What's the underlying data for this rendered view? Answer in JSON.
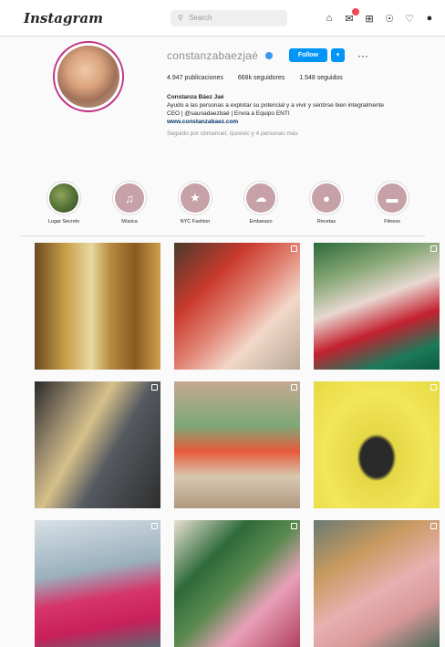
{
  "app": {
    "logo": "Instagram",
    "search_placeholder": "Search",
    "nav_icons": [
      "home-icon",
      "direct-icon",
      "new-post-icon",
      "explore-icon",
      "activity-icon",
      "profile-icon"
    ]
  },
  "profile": {
    "username": "constanzabaezjaé",
    "verified": true,
    "follow_label": "Follow",
    "more_label": "···",
    "stats": {
      "posts": "4.947 publicaciones",
      "followers": "668k seguidores",
      "following": "1.548 seguidos"
    },
    "bio": {
      "name": "Constanza Báez Jaé",
      "line1": "Ayudo a las personas a explotar su potencial y a vivir y sentirse bien integralmente",
      "line2": "CEO | @saunadaezbaé | Envía a Equipo ENTI",
      "link": "www.constanzabaez.com",
      "followed_by": "Seguido por cbmanuel, rjucevic y 4 personas más"
    }
  },
  "highlights": [
    {
      "label": "Lugar Secreto",
      "icon": "photo"
    },
    {
      "label": "Música",
      "icon": "music-icon"
    },
    {
      "label": "NYC Fashion",
      "icon": "fashion-icon"
    },
    {
      "label": "Embarazo",
      "icon": "baby-icon"
    },
    {
      "label": "Recetas",
      "icon": "apple-icon"
    },
    {
      "label": "Fitness",
      "icon": "dumbbell-icon"
    }
  ],
  "posts": [
    {
      "kind": "photo"
    },
    {
      "kind": "photo"
    },
    {
      "kind": "photo"
    },
    {
      "kind": "photo"
    },
    {
      "kind": "photo"
    },
    {
      "kind": "photo"
    },
    {
      "kind": "photo"
    },
    {
      "kind": "photo"
    },
    {
      "kind": "photo"
    }
  ],
  "colors": {
    "accent": "#0095f6",
    "highlight_circle": "#c6a1a8",
    "notification": "#ed4956"
  }
}
